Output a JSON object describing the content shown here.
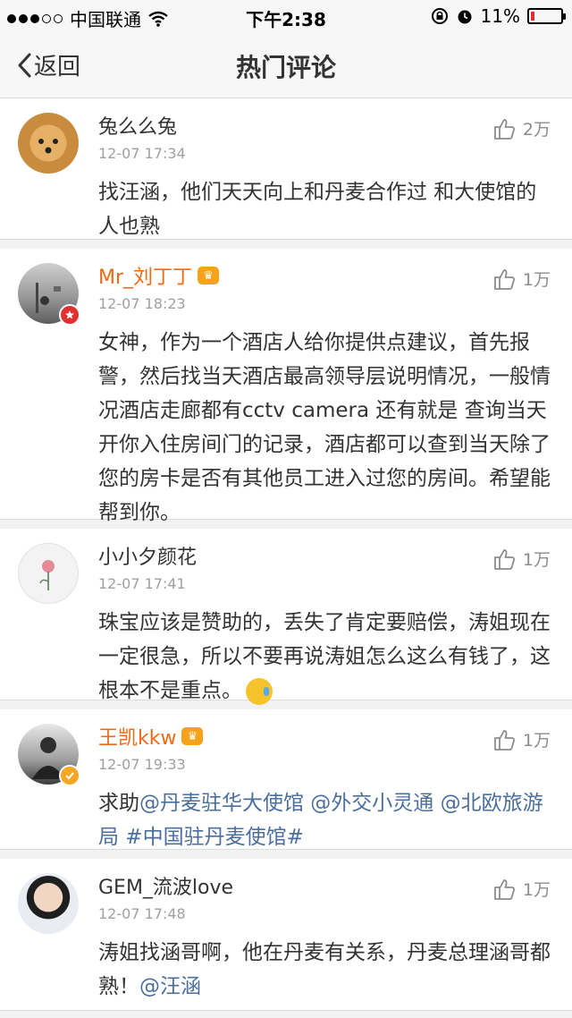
{
  "status_bar": {
    "carrier": "中国联通",
    "time": "下午2:38",
    "battery_percent": "11%",
    "battery_level": 0.11,
    "signal_bars": 3,
    "signal_total": 5
  },
  "nav": {
    "back_label": "返回",
    "title": "热门评论"
  },
  "comments": [
    {
      "name": "兔么么兔",
      "time": "12-07 17:34",
      "likes": "2万",
      "text": "找汪涵，他们天天向上和丹麦合作过 和大使馆的人也熟",
      "vip": false,
      "badge": ""
    },
    {
      "name": "Mr_刘丁丁",
      "time": "12-07 18:23",
      "likes": "1万",
      "text": "女神，作为一个酒店人给你提供点建议，首先报警，然后找当天酒店最高领导层说明情况，一般情况酒店走廊都有cctv camera 还有就是 查询当天开你入住房间门的记录，酒店都可以查到当天除了您的房卡是否有其他员工进入过您的房间。希望能帮到你。",
      "vip": true,
      "badge": "red-star"
    },
    {
      "name": "小小夕颜花",
      "time": "12-07 17:41",
      "likes": "1万",
      "text": "珠宝应该是赞助的，丢失了肯定要赔偿，涛姐现在一定很急，所以不要再说涛姐怎么这么有钱了，这根本不是重点。",
      "vip": false,
      "badge": ""
    },
    {
      "name": "王凯kkw",
      "time": "12-07 19:33",
      "likes": "1万",
      "text_prefix": "求助",
      "links": "@丹麦驻华大使馆 @外交小灵通 @北欧旅游局 #中国驻丹麦使馆#",
      "vip": true,
      "badge": "yellow-v"
    },
    {
      "name": "GEM_流波love",
      "time": "12-07 17:48",
      "likes": "1万",
      "text": "涛姐找涵哥啊，他在丹麦有关系，丹麦总理涵哥都熟！",
      "mention": "@汪涵",
      "vip": false,
      "badge": ""
    }
  ],
  "colors": {
    "vip_name": "#ef6a16",
    "link": "#4a6f9e",
    "time": "#a0a0a0"
  }
}
